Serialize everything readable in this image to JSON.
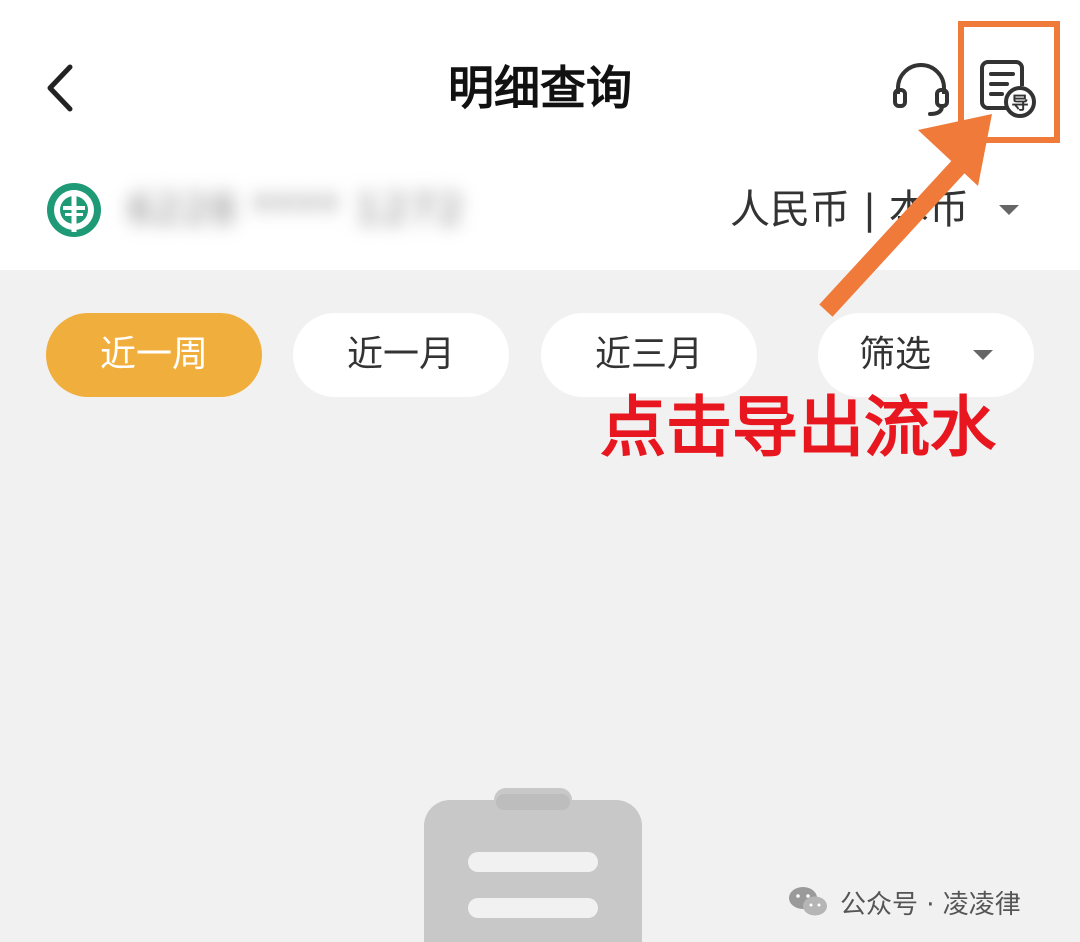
{
  "header": {
    "title": "明细查询",
    "back_icon": "chevron-left-icon",
    "customer_service_icon": "headset-icon",
    "export_icon": "export-statement-icon",
    "export_icon_char": "导"
  },
  "account": {
    "bank_logo_icon": "bank-logo-icon",
    "number_masked": "6228 **** 1272",
    "currency": "人民币 | 本币"
  },
  "filters": {
    "chips": [
      "近一周",
      "近一月",
      "近三月"
    ],
    "filter_label": "筛选",
    "active_index": 0
  },
  "annotation": {
    "text": "点击导出流水",
    "color": "#e8161e",
    "arrow_color": "#ef7a3a"
  },
  "empty_state": {
    "icon": "empty-clipboard-icon"
  },
  "watermark": {
    "icon": "wechat-icon",
    "text": "公众号 · 凌凌律"
  },
  "colors": {
    "active_chip": "#f0ae3c",
    "bank_green": "#1f9a76",
    "background": "#f1f1f1"
  }
}
